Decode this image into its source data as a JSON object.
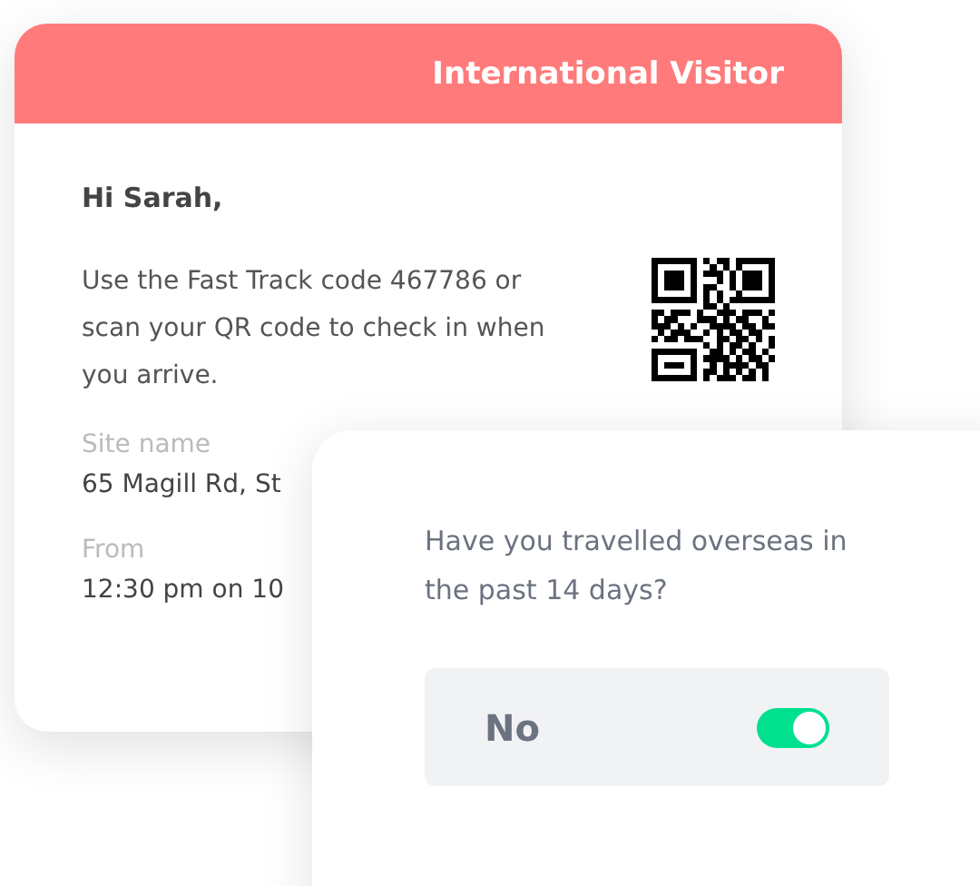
{
  "visitor_card": {
    "header": "International Visitor",
    "greeting": "Hi Sarah,",
    "message": "Use the Fast Track code 467786 or scan your QR code to check in when you arrive.",
    "fields": [
      {
        "label": "Site name",
        "value": "65 Magill Rd, St"
      },
      {
        "label": "From",
        "value": "12:30 pm on 10"
      }
    ]
  },
  "question_card": {
    "question": "Have you travelled overseas in the past 14 days?",
    "answer": {
      "label": "No",
      "on": true
    }
  }
}
